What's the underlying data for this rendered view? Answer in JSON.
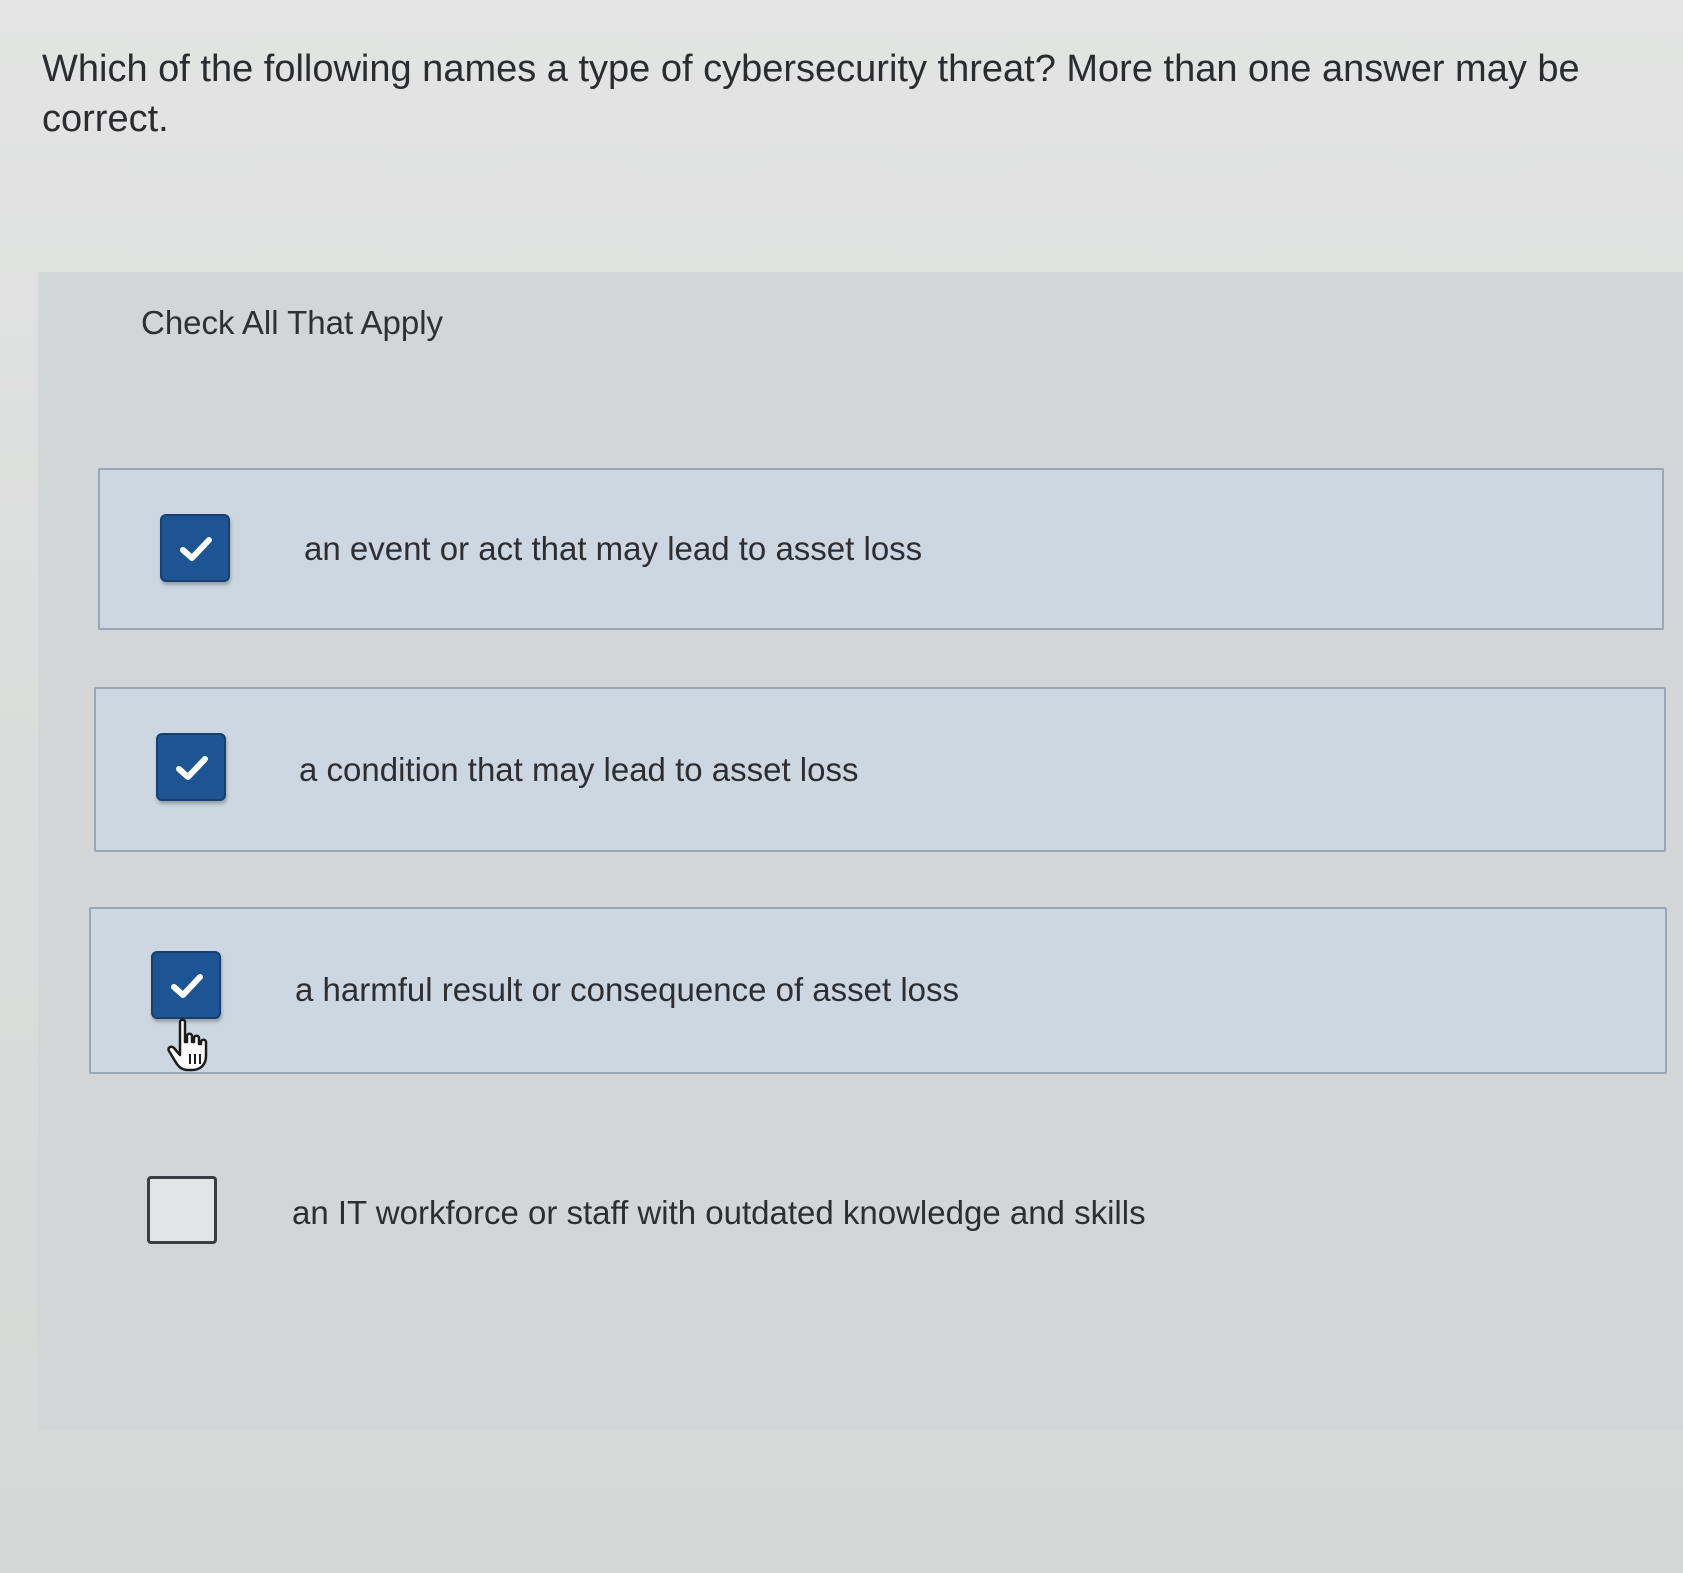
{
  "question": {
    "text": "Which of the following names a type of cybersecurity threat? More than one answer may be correct."
  },
  "instruction": "Check All That Apply",
  "options": [
    {
      "label": "an event or act that may lead to asset loss",
      "checked": true
    },
    {
      "label": "a condition that may lead to asset loss",
      "checked": true
    },
    {
      "label": "a harmful result or consequence of asset loss",
      "checked": true
    },
    {
      "label": "an IT workforce or staff with outdated knowledge and skills",
      "checked": false
    }
  ],
  "icons": {
    "check": "checkmark-icon",
    "cursor": "hand-pointer-icon"
  },
  "colors": {
    "checkbox_checked": "#1d5493",
    "option_selected_bg": "#cdd7e1",
    "option_border": "#98a6b6"
  }
}
